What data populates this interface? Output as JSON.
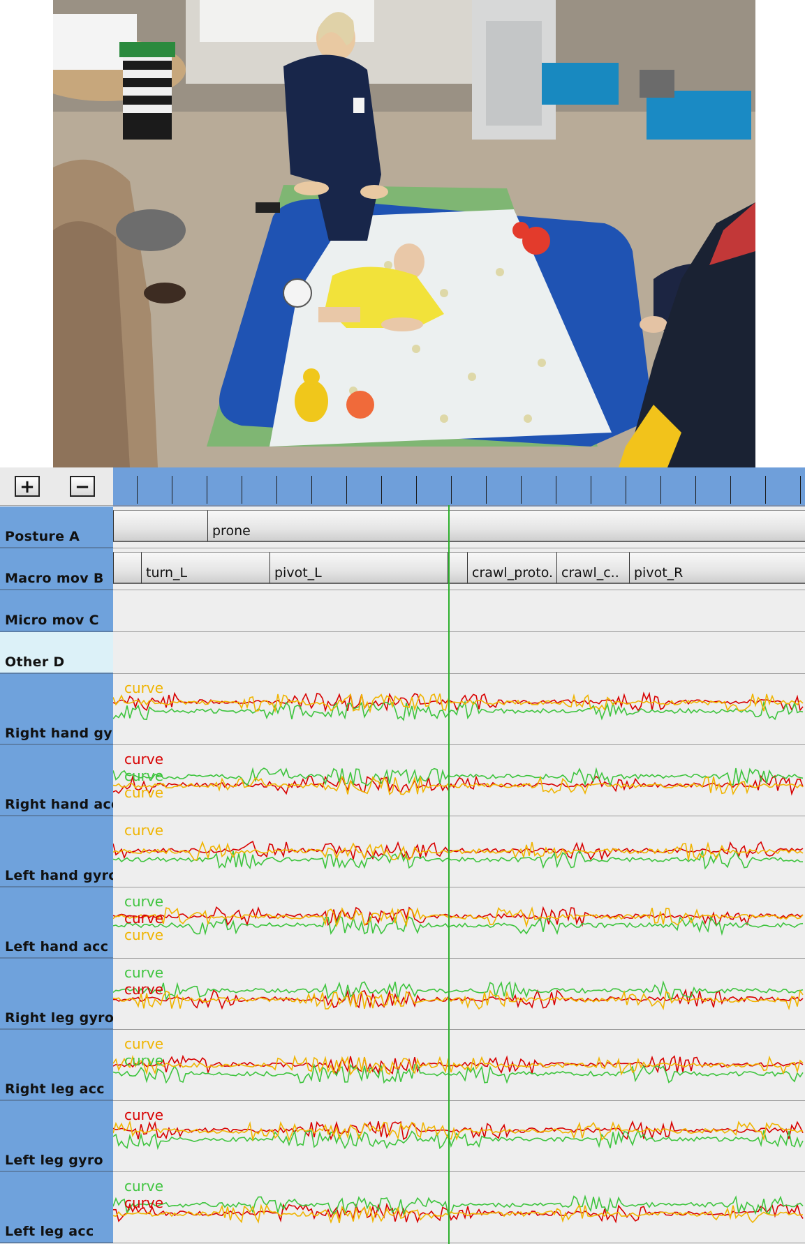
{
  "video": {
    "description_icon": "video-frame-icon"
  },
  "toolbar": {
    "zoom_in_label": "+",
    "zoom_out_label": "−"
  },
  "annotation_tracks": [
    {
      "label": "Posture A",
      "segments": [
        {
          "text": ""
        },
        {
          "text": "prone"
        },
        {
          "text": ""
        }
      ]
    },
    {
      "label": "Macro mov B",
      "segments": [
        {
          "text": ""
        },
        {
          "text": "turn_L"
        },
        {
          "text": "pivot_L"
        },
        {
          "text": ""
        },
        {
          "text": "crawl_proto."
        },
        {
          "text": "crawl_c.."
        },
        {
          "text": "pivot_R"
        }
      ]
    },
    {
      "label": "Micro mov C",
      "segments": []
    },
    {
      "label": "Other D",
      "segments": []
    }
  ],
  "signal_tracks": [
    {
      "label": "Right hand gyro",
      "curve_labels": [
        {
          "text": "curve",
          "color": "#f0b400"
        }
      ]
    },
    {
      "label": "Right hand acc",
      "curve_labels": [
        {
          "text": "curve",
          "color": "#d80000"
        },
        {
          "text": "curve",
          "color": "#3ec43e"
        },
        {
          "text": "curve",
          "color": "#f0b400"
        }
      ]
    },
    {
      "label": "Left hand gyro",
      "curve_labels": [
        {
          "text": "curve",
          "color": "#f0b400"
        }
      ]
    },
    {
      "label": "Left hand acc",
      "curve_labels": [
        {
          "text": "curve",
          "color": "#3ec43e"
        },
        {
          "text": "curve",
          "color": "#d80000"
        },
        {
          "text": "curve",
          "color": "#f0b400"
        }
      ]
    },
    {
      "label": "Right leg gyro",
      "curve_labels": [
        {
          "text": "curve",
          "color": "#3ec43e"
        },
        {
          "text": "curve",
          "color": "#d80000"
        }
      ]
    },
    {
      "label": "Right leg acc",
      "curve_labels": [
        {
          "text": "curve",
          "color": "#f0b400"
        },
        {
          "text": "curve",
          "color": "#3ec43e"
        }
      ]
    },
    {
      "label": "Left leg gyro",
      "curve_labels": [
        {
          "text": "curve",
          "color": "#d80000"
        }
      ]
    },
    {
      "label": "Left leg acc",
      "curve_labels": [
        {
          "text": "curve",
          "color": "#3ec43e"
        },
        {
          "text": "curve",
          "color": "#d80000"
        }
      ]
    }
  ],
  "colors": {
    "curve_red": "#d80000",
    "curve_green": "#3ec43e",
    "curve_yellow": "#f0b400",
    "cursor": "#2eb02e",
    "label_bg": "#6fa2dc",
    "ruler_bg": "#6f9fda"
  }
}
